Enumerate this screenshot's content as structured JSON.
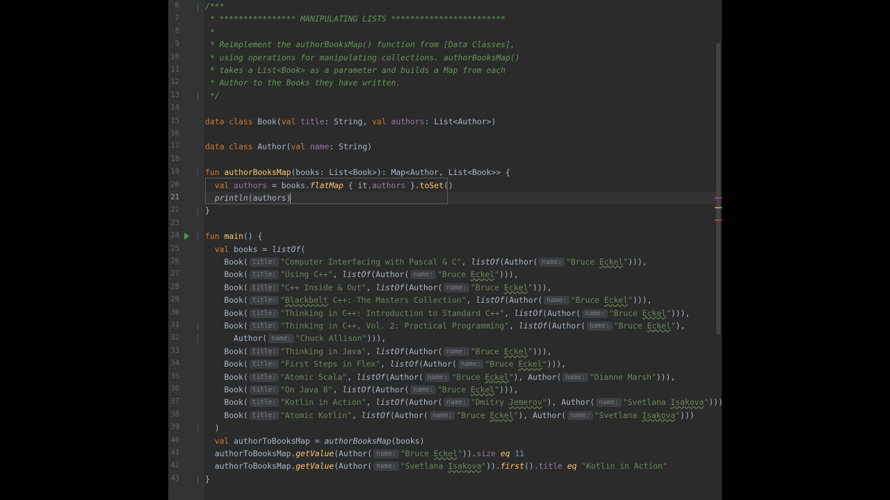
{
  "editor": {
    "current_line": 21,
    "lines": [
      {
        "n": 6,
        "fold": "⊖",
        "html": "<span class='cm'>/***</span>"
      },
      {
        "n": 7,
        "html": "<span class='cm'> * **************** MANIPULATING LISTS ************************</span>"
      },
      {
        "n": 8,
        "html": "<span class='cm'> *</span>"
      },
      {
        "n": 9,
        "html": "<span class='cm'> * Reimplement the authorBooksMap() function from [Data Classes],</span>"
      },
      {
        "n": 10,
        "html": "<span class='cm'> * using operations for manipulating collections. authorBooksMap()</span>"
      },
      {
        "n": 11,
        "html": "<span class='cm'> * takes a List&lt;Book&gt; as a parameter and builds a Map from each</span>"
      },
      {
        "n": 12,
        "html": "<span class='cm'> * Author to the Books they have written.</span>"
      },
      {
        "n": 13,
        "fold": "⊖",
        "html": "<span class='cm'> */</span>"
      },
      {
        "n": 14,
        "html": ""
      },
      {
        "n": 15,
        "html": "<span class='kw'>data class</span> Book(<span class='kw'>val</span> <span class='prop'>title</span>: String, <span class='kw'>val</span> <span class='prop'>authors</span>: List&lt;Author&gt;)"
      },
      {
        "n": 16,
        "html": ""
      },
      {
        "n": 17,
        "html": "<span class='kw'>data class</span> Author(<span class='kw'>val</span> <span class='prop'>name</span>: String)"
      },
      {
        "n": 18,
        "html": ""
      },
      {
        "n": 19,
        "fold": "⊖",
        "html": "<span class='kw'>fun</span> <span class='fn'>authorBooksMap</span>(books: List&lt;Book&gt;): Map&lt;Author, List&lt;Book&gt;&gt; {"
      },
      {
        "n": 20,
        "html": "  <span class='kw'>val</span> <span class='prop'>authors</span> = books.<span class='fn it'>flatMap</span> { it.<span class='prop'>authors</span> }.<span class='fn'>toSet</span>()"
      },
      {
        "n": 21,
        "html": "  <span class='it'>println</span>(authors)"
      },
      {
        "n": 22,
        "fold": "⊖",
        "html": "}"
      },
      {
        "n": 23,
        "html": ""
      },
      {
        "n": 24,
        "run": true,
        "fold": "⊖",
        "html": "<span class='kw'>fun</span> <span class='fn'>main</span>() {"
      },
      {
        "n": 25,
        "html": "  <span class='kw'>val</span> books = <span class='it'>listOf</span>("
      },
      {
        "n": 26,
        "html": "    Book(<span class='hint'>title:</span><span class='str'>\"Computer Interfacing with Pascal &amp; C\"</span>, <span class='it'>listOf</span>(Author(<span class='hint'>name:</span><span class='str'>\"Bruce <span class='ul'>Eckel</span>\"</span>))),"
      },
      {
        "n": 27,
        "html": "    Book(<span class='hint'>title:</span><span class='str'>\"Using C++\"</span>, <span class='it'>listOf</span>(Author(<span class='hint'>name:</span><span class='str'>\"Bruce <span class='ul'>Eckel</span>\"</span>))),"
      },
      {
        "n": 28,
        "html": "    Book(<span class='hint'>title:</span><span class='str'>\"C++ Inside &amp; Out\"</span>, <span class='it'>listOf</span>(Author(<span class='hint'>name:</span><span class='str'>\"Bruce <span class='ul'>Eckel</span>\"</span>))),"
      },
      {
        "n": 29,
        "html": "    Book(<span class='hint'>title:</span><span class='str'>\"<span class='ul'>Blackbelt</span> C++: The Masters Collection\"</span>, <span class='it'>listOf</span>(Author(<span class='hint'>name:</span><span class='str'>\"Bruce <span class='ul'>Eckel</span>\"</span>))),"
      },
      {
        "n": 30,
        "html": "    Book(<span class='hint'>title:</span><span class='str'>\"Thinking in C++: Introduction to Standard C++\"</span>, <span class='it'>listOf</span>(Author(<span class='hint'>name:</span><span class='str'>\"Bruce <span class='ul'>Eckel</span>\"</span>))),"
      },
      {
        "n": 31,
        "fold": "⊖",
        "html": "    Book(<span class='hint'>title:</span><span class='str'>\"Thinking in C++, Vol. 2: Practical Programming\"</span>, <span class='it'>listOf</span>(Author(<span class='hint'>name:</span><span class='str'>\"Bruce <span class='ul'>Eckel</span>\"</span>),"
      },
      {
        "n": 32,
        "fold": "⊖",
        "html": "      Author(<span class='hint'>name:</span><span class='str'>\"Chuck Allison\"</span>))),"
      },
      {
        "n": 33,
        "html": "    Book(<span class='hint'>title:</span><span class='str'>\"Thinking in Java\"</span>, <span class='it'>listOf</span>(Author(<span class='hint'>name:</span><span class='str'>\"Bruce <span class='ul'>Eckel</span>\"</span>))),"
      },
      {
        "n": 34,
        "html": "    Book(<span class='hint'>title:</span><span class='str'>\"First Steps in Flex\"</span>, <span class='it'>listOf</span>(Author(<span class='hint'>name:</span><span class='str'>\"Bruce <span class='ul'>Eckel</span>\"</span>))),"
      },
      {
        "n": 35,
        "html": "    Book(<span class='hint'>title:</span><span class='str'>\"Atomic Scala\"</span>, <span class='it'>listOf</span>(Author(<span class='hint'>name:</span><span class='str'>\"Bruce <span class='ul'>Eckel</span>\"</span>), Author(<span class='hint'>name:</span><span class='str'>\"Dianne Marsh\"</span>))),"
      },
      {
        "n": 36,
        "html": "    Book(<span class='hint'>title:</span><span class='str'>\"On Java 8\"</span>, <span class='it'>listOf</span>(Author(<span class='hint'>name:</span><span class='str'>\"Bruce <span class='ul'>Eckel</span>\"</span>))),"
      },
      {
        "n": 37,
        "html": "    Book(<span class='hint'>title:</span><span class='str'>\"Kotlin in Action\"</span>, <span class='it'>listOf</span>(Author(<span class='hint'>name:</span><span class='str'>\"Dmitry <span class='ul'>Jemerov</span>\"</span>), Author(<span class='hint'>name:</span><span class='str'>\"Svetlana <span class='ul'>Isakova</span>\"</span>))),"
      },
      {
        "n": 38,
        "html": "    Book(<span class='hint'>title:</span><span class='str'>\"Atomic Kotlin\"</span>, <span class='it'>listOf</span>(Author(<span class='hint'>name:</span><span class='str'>\"Bruce <span class='ul'>Eckel</span>\"</span>), Author(<span class='hint'>name:</span><span class='str'>\"Svetlana <span class='ul'>Isakova</span>\"</span>)))"
      },
      {
        "n": 39,
        "fold": "⊖",
        "html": "  )"
      },
      {
        "n": 40,
        "html": "  <span class='kw'>val</span> authorToBooksMap = <span class='it'>authorBooksMap</span>(books)"
      },
      {
        "n": 41,
        "html": "  authorToBooksMap.<span class='fn it'>getValue</span>(Author(<span class='hint'>name:</span><span class='str'>\"Bruce <span class='ul'>Eckel</span>\"</span>)).<span class='prop'>size</span> <span class='fn it'>eq</span> <span class='num'>11</span>"
      },
      {
        "n": 42,
        "html": "  authorToBooksMap.<span class='fn it'>getValue</span>(Author(<span class='hint'>name:</span><span class='str'>\"Svetlana <span class='ul'>Isakova</span>\"</span>)).<span class='fn it'>first</span>().<span class='prop'>title</span> <span class='fn it'>eq</span> <span class='str'>\"Kotlin in Action\"</span>"
      },
      {
        "n": 43,
        "fold": "⊖",
        "html": "}"
      }
    ]
  }
}
